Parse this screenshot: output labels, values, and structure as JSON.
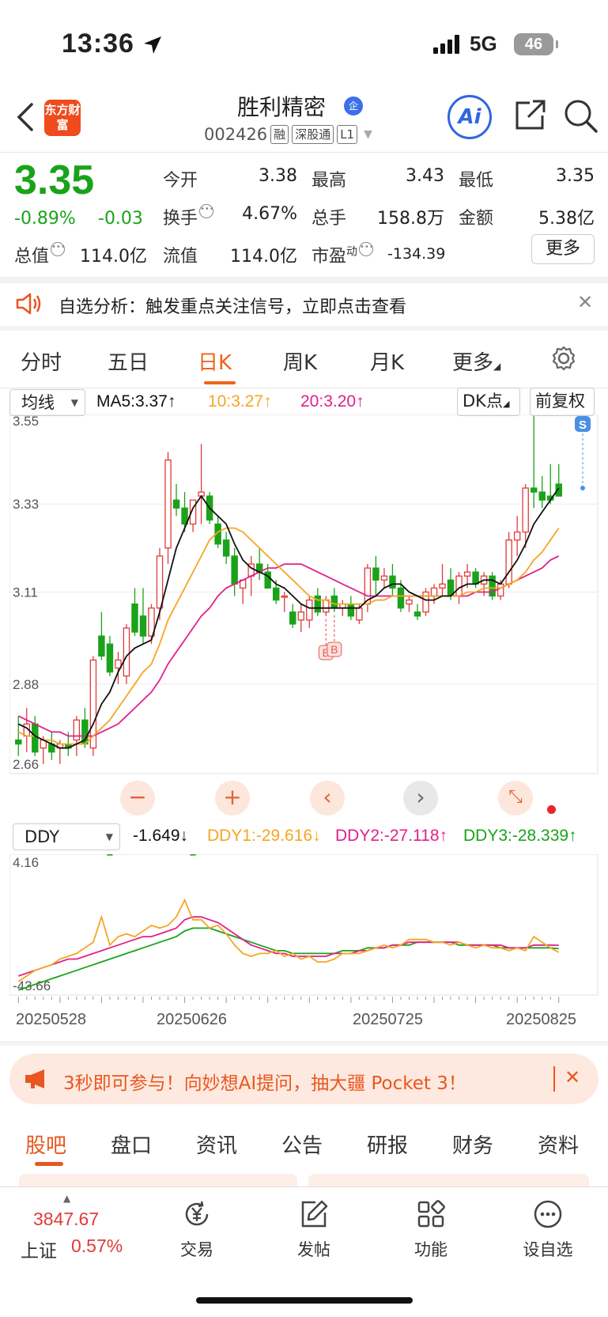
{
  "status_bar": {
    "time": "13:36",
    "network": "5G",
    "battery": "46"
  },
  "header": {
    "logo_text": "东方财富",
    "stock_name": "胜利精密",
    "name_badge": "企",
    "stock_code": "002426",
    "tags": [
      "融",
      "深股通",
      "L1"
    ],
    "ai_label": "Ai"
  },
  "quote": {
    "price": "3.35",
    "change_pct": "-0.89%",
    "change": "-0.03",
    "open_label": "今开",
    "open": "3.38",
    "high_label": "最高",
    "high": "3.43",
    "low_label": "最低",
    "low": "3.35",
    "turnover_label": "换手",
    "turnover": "4.67%",
    "volume_label": "总手",
    "volume": "158.8万",
    "amount_label": "金额",
    "amount": "5.38亿",
    "mktcap_label": "总值",
    "mktcap": "114.0亿",
    "float_label": "流值",
    "float_cap": "114.0亿",
    "pe_label": "市盈",
    "pe_sup": "动",
    "pe": "-134.39",
    "more_label": "更多"
  },
  "alert": {
    "text": "自选分析：触发重点关注信号，立即点击查看"
  },
  "chart_tabs": [
    "分时",
    "五日",
    "日K",
    "周K",
    "月K",
    "更多"
  ],
  "indicator_bar": {
    "selector": "均线",
    "ma5": "MA5:3.37↑",
    "ma10": "10:3.27↑",
    "ma20": "20:3.20↑",
    "dk_label": "DK点",
    "adjust_label": "前复权"
  },
  "kline_axis": {
    "ticks": [
      "3.55",
      "3.33",
      "3.11",
      "2.88",
      "2.66"
    ]
  },
  "markers": {
    "b_label": "B",
    "s_label": "S"
  },
  "ddy_bar": {
    "selector": "DDY",
    "ddy": "-1.649↓",
    "ddy1": "DDY1:-29.616↓",
    "ddy2": "DDY2:-27.118↑",
    "ddy3": "DDY3:-28.339↑",
    "top": "4.16",
    "bottom": "-43.66"
  },
  "dates": [
    "20250528",
    "20250626",
    "20250725",
    "20250825"
  ],
  "colors": {
    "up": "#e23a3a",
    "down": "#1aa31a",
    "accent": "#f0651c",
    "ma5": "#111111",
    "ma10": "#f5a623",
    "ma20": "#e0218a"
  },
  "promo": {
    "text": "3秒即可参与！向妙想AI提问，抽大疆 Pocket 3！"
  },
  "bottom_tabs": [
    "股吧",
    "盘口",
    "资讯",
    "公告",
    "研报",
    "财务",
    "资料"
  ],
  "index_widget": {
    "value": "3847.67",
    "name": "上证",
    "change": "0.57%"
  },
  "nav": [
    "交易",
    "发帖",
    "功能",
    "设自选"
  ],
  "chart_data": {
    "type": "candlestick",
    "ylim": [
      2.66,
      3.55
    ],
    "candles": [
      [
        2.74,
        2.8,
        2.7,
        2.73
      ],
      [
        2.75,
        2.82,
        2.71,
        2.78
      ],
      [
        2.78,
        2.8,
        2.7,
        2.71
      ],
      [
        2.72,
        2.75,
        2.68,
        2.74
      ],
      [
        2.73,
        2.76,
        2.69,
        2.71
      ],
      [
        2.72,
        2.74,
        2.68,
        2.73
      ],
      [
        2.73,
        2.76,
        2.7,
        2.72
      ],
      [
        2.74,
        2.8,
        2.7,
        2.79
      ],
      [
        2.79,
        2.82,
        2.72,
        2.73
      ],
      [
        2.72,
        2.95,
        2.7,
        2.94
      ],
      [
        3.0,
        3.06,
        2.94,
        2.95
      ],
      [
        2.98,
        3.0,
        2.9,
        2.91
      ],
      [
        2.92,
        2.96,
        2.88,
        2.94
      ],
      [
        2.9,
        3.03,
        2.88,
        3.02
      ],
      [
        3.08,
        3.12,
        3.0,
        3.01
      ],
      [
        3.05,
        3.12,
        2.98,
        3.0
      ],
      [
        3.0,
        3.08,
        2.98,
        3.07
      ],
      [
        3.07,
        3.22,
        3.04,
        3.2
      ],
      [
        3.22,
        3.46,
        3.18,
        3.44
      ],
      [
        3.34,
        3.38,
        3.3,
        3.32
      ],
      [
        3.32,
        3.36,
        3.26,
        3.28
      ],
      [
        3.28,
        3.34,
        3.26,
        3.34
      ],
      [
        3.35,
        3.48,
        3.28,
        3.36
      ],
      [
        3.35,
        3.36,
        3.28,
        3.29
      ],
      [
        3.28,
        3.3,
        3.22,
        3.23
      ],
      [
        3.24,
        3.26,
        3.18,
        3.2
      ],
      [
        3.2,
        3.22,
        3.1,
        3.13
      ],
      [
        3.12,
        3.14,
        3.08,
        3.14
      ],
      [
        3.15,
        3.2,
        3.1,
        3.18
      ],
      [
        3.18,
        3.22,
        3.14,
        3.16
      ],
      [
        3.16,
        3.18,
        3.12,
        3.12
      ],
      [
        3.12,
        3.14,
        3.08,
        3.09
      ],
      [
        3.1,
        3.11,
        3.06,
        3.1
      ],
      [
        3.06,
        3.08,
        3.02,
        3.03
      ],
      [
        3.04,
        3.08,
        3.01,
        3.06
      ],
      [
        3.04,
        3.1,
        3.02,
        3.09
      ],
      [
        3.1,
        3.12,
        3.05,
        3.06
      ],
      [
        3.06,
        3.1,
        3.05,
        3.09
      ],
      [
        3.1,
        3.12,
        3.06,
        3.07
      ],
      [
        3.07,
        3.09,
        3.05,
        3.08
      ],
      [
        3.08,
        3.1,
        3.04,
        3.05
      ],
      [
        3.04,
        3.08,
        3.03,
        3.07
      ],
      [
        3.08,
        3.18,
        3.06,
        3.17
      ],
      [
        3.17,
        3.2,
        3.1,
        3.14
      ],
      [
        3.14,
        3.17,
        3.12,
        3.15
      ],
      [
        3.15,
        3.18,
        3.1,
        3.12
      ],
      [
        3.12,
        3.14,
        3.06,
        3.07
      ],
      [
        3.08,
        3.1,
        3.06,
        3.09
      ],
      [
        3.06,
        3.08,
        3.04,
        3.05
      ],
      [
        3.06,
        3.12,
        3.05,
        3.11
      ],
      [
        3.1,
        3.13,
        3.08,
        3.12
      ],
      [
        3.12,
        3.18,
        3.1,
        3.13
      ],
      [
        3.14,
        3.17,
        3.09,
        3.1
      ],
      [
        3.1,
        3.16,
        3.08,
        3.15
      ],
      [
        3.15,
        3.18,
        3.12,
        3.16
      ],
      [
        3.16,
        3.17,
        3.12,
        3.13
      ],
      [
        3.13,
        3.16,
        3.1,
        3.15
      ],
      [
        3.15,
        3.16,
        3.09,
        3.1
      ],
      [
        3.1,
        3.14,
        3.09,
        3.13
      ],
      [
        3.13,
        3.26,
        3.12,
        3.24
      ],
      [
        3.24,
        3.3,
        3.2,
        3.26
      ],
      [
        3.26,
        3.38,
        3.22,
        3.37
      ],
      [
        3.37,
        3.55,
        3.32,
        3.36
      ],
      [
        3.36,
        3.4,
        3.32,
        3.34
      ],
      [
        3.35,
        3.43,
        3.33,
        3.34
      ],
      [
        3.38,
        3.43,
        3.35,
        3.35
      ]
    ],
    "ma5": [
      2.78,
      2.77,
      2.75,
      2.74,
      2.73,
      2.72,
      2.72,
      2.73,
      2.74,
      2.78,
      2.83,
      2.86,
      2.91,
      2.95,
      2.97,
      2.98,
      2.99,
      3.06,
      3.14,
      3.22,
      3.27,
      3.32,
      3.35,
      3.32,
      3.3,
      3.28,
      3.23,
      3.19,
      3.17,
      3.16,
      3.15,
      3.13,
      3.12,
      3.1,
      3.08,
      3.07,
      3.07,
      3.07,
      3.07,
      3.07,
      3.07,
      3.07,
      3.09,
      3.1,
      3.12,
      3.13,
      3.13,
      3.11,
      3.1,
      3.09,
      3.09,
      3.1,
      3.1,
      3.12,
      3.13,
      3.13,
      3.14,
      3.14,
      3.13,
      3.16,
      3.19,
      3.23,
      3.28,
      3.31,
      3.34,
      3.37
    ],
    "ma10": [
      2.76,
      2.75,
      2.75,
      2.74,
      2.74,
      2.73,
      2.73,
      2.73,
      2.73,
      2.75,
      2.77,
      2.79,
      2.82,
      2.85,
      2.88,
      2.91,
      2.93,
      2.98,
      3.04,
      3.08,
      3.12,
      3.16,
      3.2,
      3.24,
      3.26,
      3.27,
      3.27,
      3.26,
      3.24,
      3.22,
      3.2,
      3.18,
      3.16,
      3.14,
      3.12,
      3.1,
      3.09,
      3.09,
      3.08,
      3.08,
      3.08,
      3.08,
      3.08,
      3.09,
      3.09,
      3.1,
      3.1,
      3.1,
      3.1,
      3.1,
      3.1,
      3.1,
      3.1,
      3.1,
      3.11,
      3.11,
      3.12,
      3.12,
      3.12,
      3.13,
      3.14,
      3.16,
      3.19,
      3.21,
      3.24,
      3.27
    ],
    "ma20": [
      2.8,
      2.79,
      2.78,
      2.77,
      2.76,
      2.76,
      2.75,
      2.75,
      2.75,
      2.75,
      2.76,
      2.77,
      2.78,
      2.8,
      2.82,
      2.84,
      2.86,
      2.89,
      2.93,
      2.96,
      2.99,
      3.02,
      3.05,
      3.07,
      3.1,
      3.12,
      3.13,
      3.14,
      3.15,
      3.16,
      3.17,
      3.17,
      3.18,
      3.18,
      3.18,
      3.17,
      3.16,
      3.15,
      3.14,
      3.13,
      3.12,
      3.11,
      3.1,
      3.1,
      3.1,
      3.1,
      3.1,
      3.1,
      3.1,
      3.1,
      3.1,
      3.1,
      3.1,
      3.1,
      3.1,
      3.11,
      3.11,
      3.11,
      3.12,
      3.13,
      3.14,
      3.15,
      3.16,
      3.17,
      3.19,
      3.2
    ],
    "ddy_bars": [
      0,
      0,
      0,
      -0.4,
      0,
      0,
      0.6,
      0,
      -0.5,
      0,
      4.0,
      -4.0,
      -2.5,
      -1.0,
      0.8,
      -1.2,
      1.0,
      0,
      -1.5,
      1.5,
      2.5,
      -4.0,
      -3.5,
      -2.0,
      0,
      -1.0,
      -2.0,
      -1.5,
      0,
      -1.2,
      -2.0,
      0,
      -1.5,
      -1.0,
      0,
      -1.3,
      -0.8,
      0,
      -1.2,
      0,
      -1.0,
      -0.8,
      0,
      0,
      1.0,
      0,
      -0.8,
      -1.0,
      0,
      -1.0,
      -0.8,
      -1.2,
      -0.5,
      0,
      -1.5,
      -1.0,
      -1.2,
      0,
      0,
      -1.5,
      -0.8,
      1.0,
      2.5,
      1.0,
      -1.0,
      -1.6
    ],
    "ddy1": [
      -40,
      -38,
      -36,
      -35,
      -34,
      -32,
      -31,
      -30,
      -28,
      -26,
      -17,
      -27,
      -24,
      -23,
      -24,
      -22,
      -20,
      -21,
      -20,
      -17,
      -11,
      -18,
      -18,
      -21,
      -20,
      -23,
      -27,
      -30,
      -31,
      -30,
      -30,
      -29,
      -31,
      -30,
      -32,
      -31,
      -33,
      -33,
      -32,
      -30,
      -30,
      -30,
      -29,
      -28,
      -27,
      -28,
      -27,
      -25,
      -25,
      -25,
      -26,
      -26,
      -27,
      -26,
      -27,
      -28,
      -27,
      -28,
      -28,
      -29,
      -28,
      -29,
      -24,
      -26,
      -28,
      -29.6
    ],
    "ddy2": [
      -38,
      -37,
      -36,
      -35,
      -34,
      -33,
      -32,
      -32,
      -31,
      -30,
      -29,
      -28,
      -27,
      -26,
      -25,
      -24,
      -24,
      -23,
      -22,
      -21,
      -18,
      -17,
      -17,
      -18,
      -19,
      -21,
      -23,
      -25,
      -27,
      -28,
      -29,
      -30,
      -30,
      -31,
      -31,
      -31,
      -31,
      -31,
      -30,
      -30,
      -30,
      -29,
      -29,
      -28,
      -28,
      -27,
      -27,
      -26,
      -26,
      -26,
      -26,
      -26,
      -26,
      -26,
      -27,
      -27,
      -27,
      -27,
      -27,
      -28,
      -28,
      -28,
      -27,
      -27,
      -27,
      -27.1
    ],
    "ddy3": [
      -43,
      -42,
      -41,
      -40,
      -39,
      -38,
      -37,
      -36,
      -35,
      -34,
      -33,
      -32,
      -31,
      -30,
      -29,
      -28,
      -27,
      -26,
      -25,
      -24,
      -22,
      -21,
      -21,
      -21,
      -22,
      -23,
      -24,
      -25,
      -26,
      -27,
      -28,
      -29,
      -29,
      -30,
      -30,
      -30,
      -30,
      -30,
      -30,
      -29,
      -29,
      -29,
      -28,
      -28,
      -28,
      -27,
      -27,
      -27,
      -26,
      -26,
      -26,
      -26,
      -26,
      -27,
      -27,
      -27,
      -27,
      -27,
      -28,
      -28,
      -28,
      -28,
      -28,
      -28,
      -28,
      -28.3
    ]
  }
}
